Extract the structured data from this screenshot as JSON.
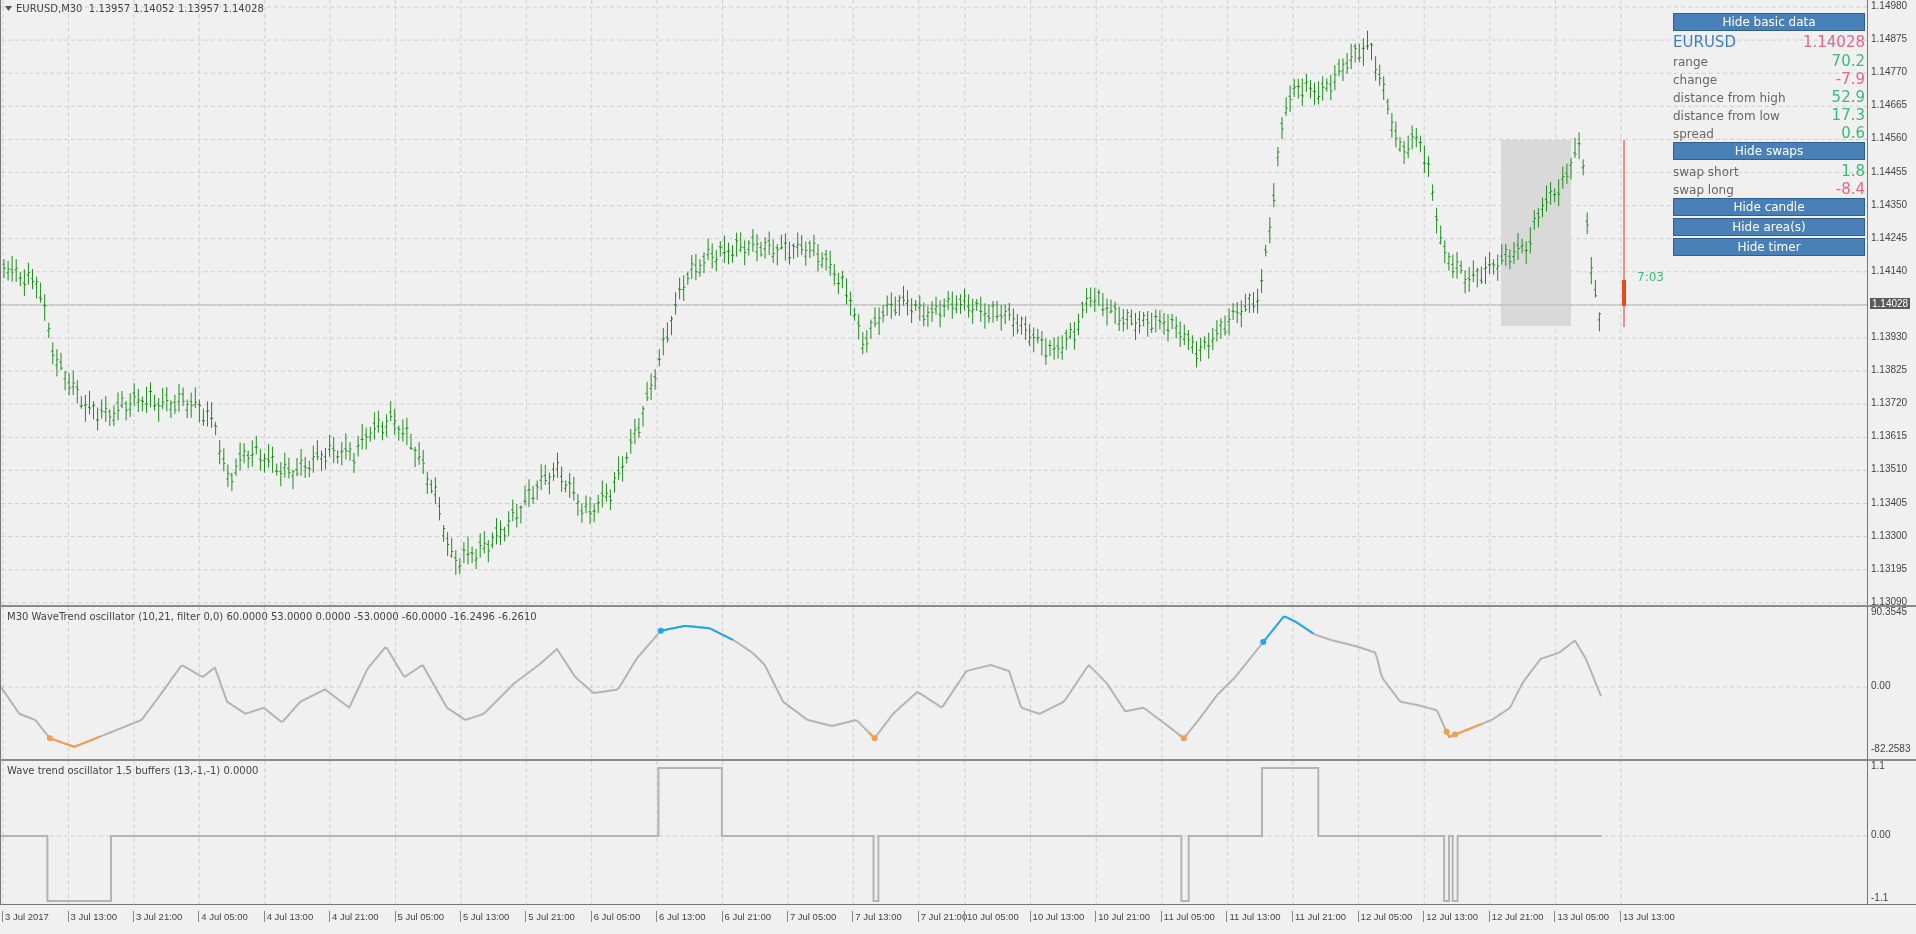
{
  "chart": {
    "header": "EURUSD,M30  1.13957 1.14052 1.13957 1.14028",
    "price_ticks": [
      "1.14980",
      "1.14875",
      "1.14770",
      "1.14665",
      "1.14560",
      "1.14455",
      "1.14350",
      "1.14245",
      "1.14140",
      "1.13930",
      "1.13825",
      "1.13720",
      "1.13615",
      "1.13510",
      "1.13405",
      "1.13300",
      "1.13195",
      "1.13090"
    ],
    "current_price": "1.14028",
    "timer": "7:03"
  },
  "panel": [
    {
      "kind": "button",
      "label": "Hide basic data"
    },
    {
      "kind": "symbol",
      "label": "EURUSD",
      "value": "1.14028",
      "color": "#e8648c"
    },
    {
      "kind": "row",
      "label": "range",
      "value": "70.2",
      "color": "#3cb878"
    },
    {
      "kind": "row",
      "label": "change",
      "value": "-7.9",
      "color": "#e8648c"
    },
    {
      "kind": "row",
      "label": "distance from high",
      "value": "52.9",
      "color": "#3cb878"
    },
    {
      "kind": "row",
      "label": "distance from low",
      "value": "17.3",
      "color": "#3cb878"
    },
    {
      "kind": "row",
      "label": "spread",
      "value": "0.6",
      "color": "#3cb878"
    },
    {
      "kind": "button",
      "label": "Hide swaps"
    },
    {
      "kind": "row",
      "label": "swap short",
      "value": "1.8",
      "color": "#3cb878"
    },
    {
      "kind": "row",
      "label": "swap long",
      "value": "-8.4",
      "color": "#e8648c"
    },
    {
      "kind": "button",
      "label": "Hide candle"
    },
    {
      "kind": "button",
      "label": "Hide area(s)"
    },
    {
      "kind": "button",
      "label": "Hide timer"
    }
  ],
  "oscillator": {
    "title": "M30 WaveTrend oscillator (10,21, filter 0,0) 60.0000 53.0000 0.0000 -53.0000 -60.0000 -16.2496 -6.2610",
    "ticks": [
      "90.3545",
      "0.00",
      "-82.2583"
    ]
  },
  "buffers": {
    "title": "Wave trend oscillator 1.5 buffers (13,-1,-1) 0.0000",
    "ticks": [
      "1.1",
      "0.00",
      "-1.1"
    ]
  },
  "time_axis": [
    "3 Jul 2017",
    "3 Jul 13:00",
    "3 Jul 21:00",
    "4 Jul 05:00",
    "4 Jul 13:00",
    "4 Jul 21:00",
    "5 Jul 05:00",
    "5 Jul 13:00",
    "5 Jul 21:00",
    "6 Jul 05:00",
    "6 Jul 13:00",
    "6 Jul 21:00",
    "7 Jul 05:00",
    "7 Jul 13:00",
    "7 Jul 21:00",
    "10 Jul 05:00",
    "10 Jul 13:00",
    "10 Jul 21:00",
    "11 Jul 05:00",
    "11 Jul 13:00",
    "11 Jul 21:00",
    "12 Jul 05:00",
    "12 Jul 13:00",
    "12 Jul 21:00",
    "13 Jul 05:00",
    "13 Jul 13:00"
  ]
}
